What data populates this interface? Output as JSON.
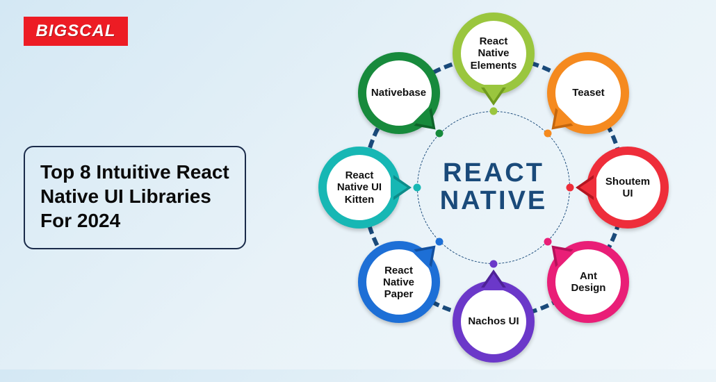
{
  "logo": {
    "text": "BIGSCAL"
  },
  "title": "Top 8 Intuitive React Native UI Libraries For 2024",
  "center": {
    "line1": "REACT",
    "line2": "NATIVE"
  },
  "nodes": [
    {
      "label": "React Native Elements",
      "color": "#9ac63e",
      "shade": "#6f9a1e",
      "angle": 270
    },
    {
      "label": "Teaset",
      "color": "#f58a1f",
      "shade": "#c4660d",
      "angle": 315
    },
    {
      "label": "Shoutem UI",
      "color": "#ee2d3a",
      "shade": "#b31521",
      "angle": 0
    },
    {
      "label": "Ant Design",
      "color": "#e91e77",
      "shade": "#b5115a",
      "angle": 45
    },
    {
      "label": "Nachos UI",
      "color": "#6b38c9",
      "shade": "#4d2296",
      "angle": 90
    },
    {
      "label": "React Native Paper",
      "color": "#1d6fd6",
      "shade": "#124f9e",
      "angle": 135
    },
    {
      "label": "React Native UI Kitten",
      "color": "#17b7b4",
      "shade": "#0d8c8a",
      "angle": 180
    },
    {
      "label": "Nativebase",
      "color": "#178a3c",
      "shade": "#0e6329",
      "angle": 225
    }
  ]
}
